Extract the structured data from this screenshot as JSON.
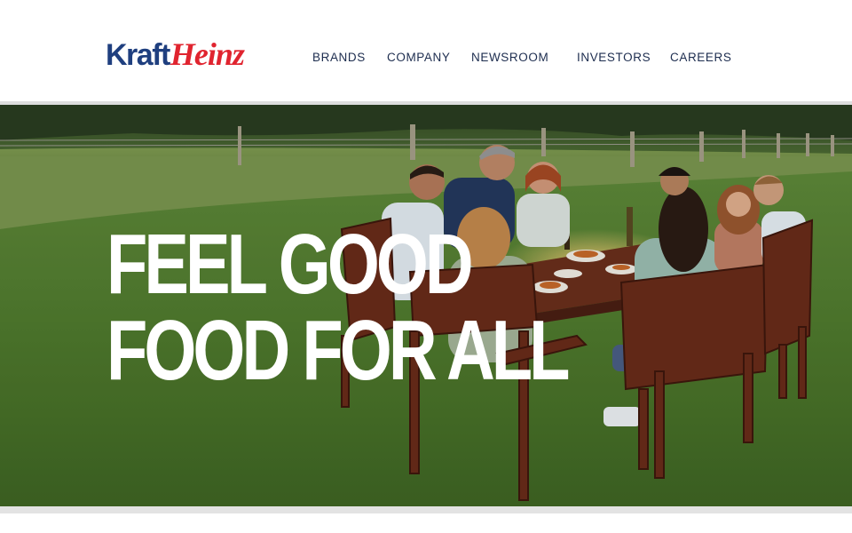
{
  "logo": {
    "part1": "Kraft",
    "part2": "Heinz"
  },
  "nav": [
    {
      "label": "BRANDS"
    },
    {
      "label": "COMPANY"
    },
    {
      "label": "NEWSROOM"
    },
    {
      "label": "INVESTORS"
    },
    {
      "label": "CAREERS"
    }
  ],
  "hero": {
    "headline_line1": "FEEL GOOD",
    "headline_line2": "FOOD FOR ALL"
  },
  "colors": {
    "logo_blue": "#1f3f7f",
    "logo_red": "#e0242f",
    "nav_text": "#1d2d4f",
    "headline": "#ffffff"
  }
}
